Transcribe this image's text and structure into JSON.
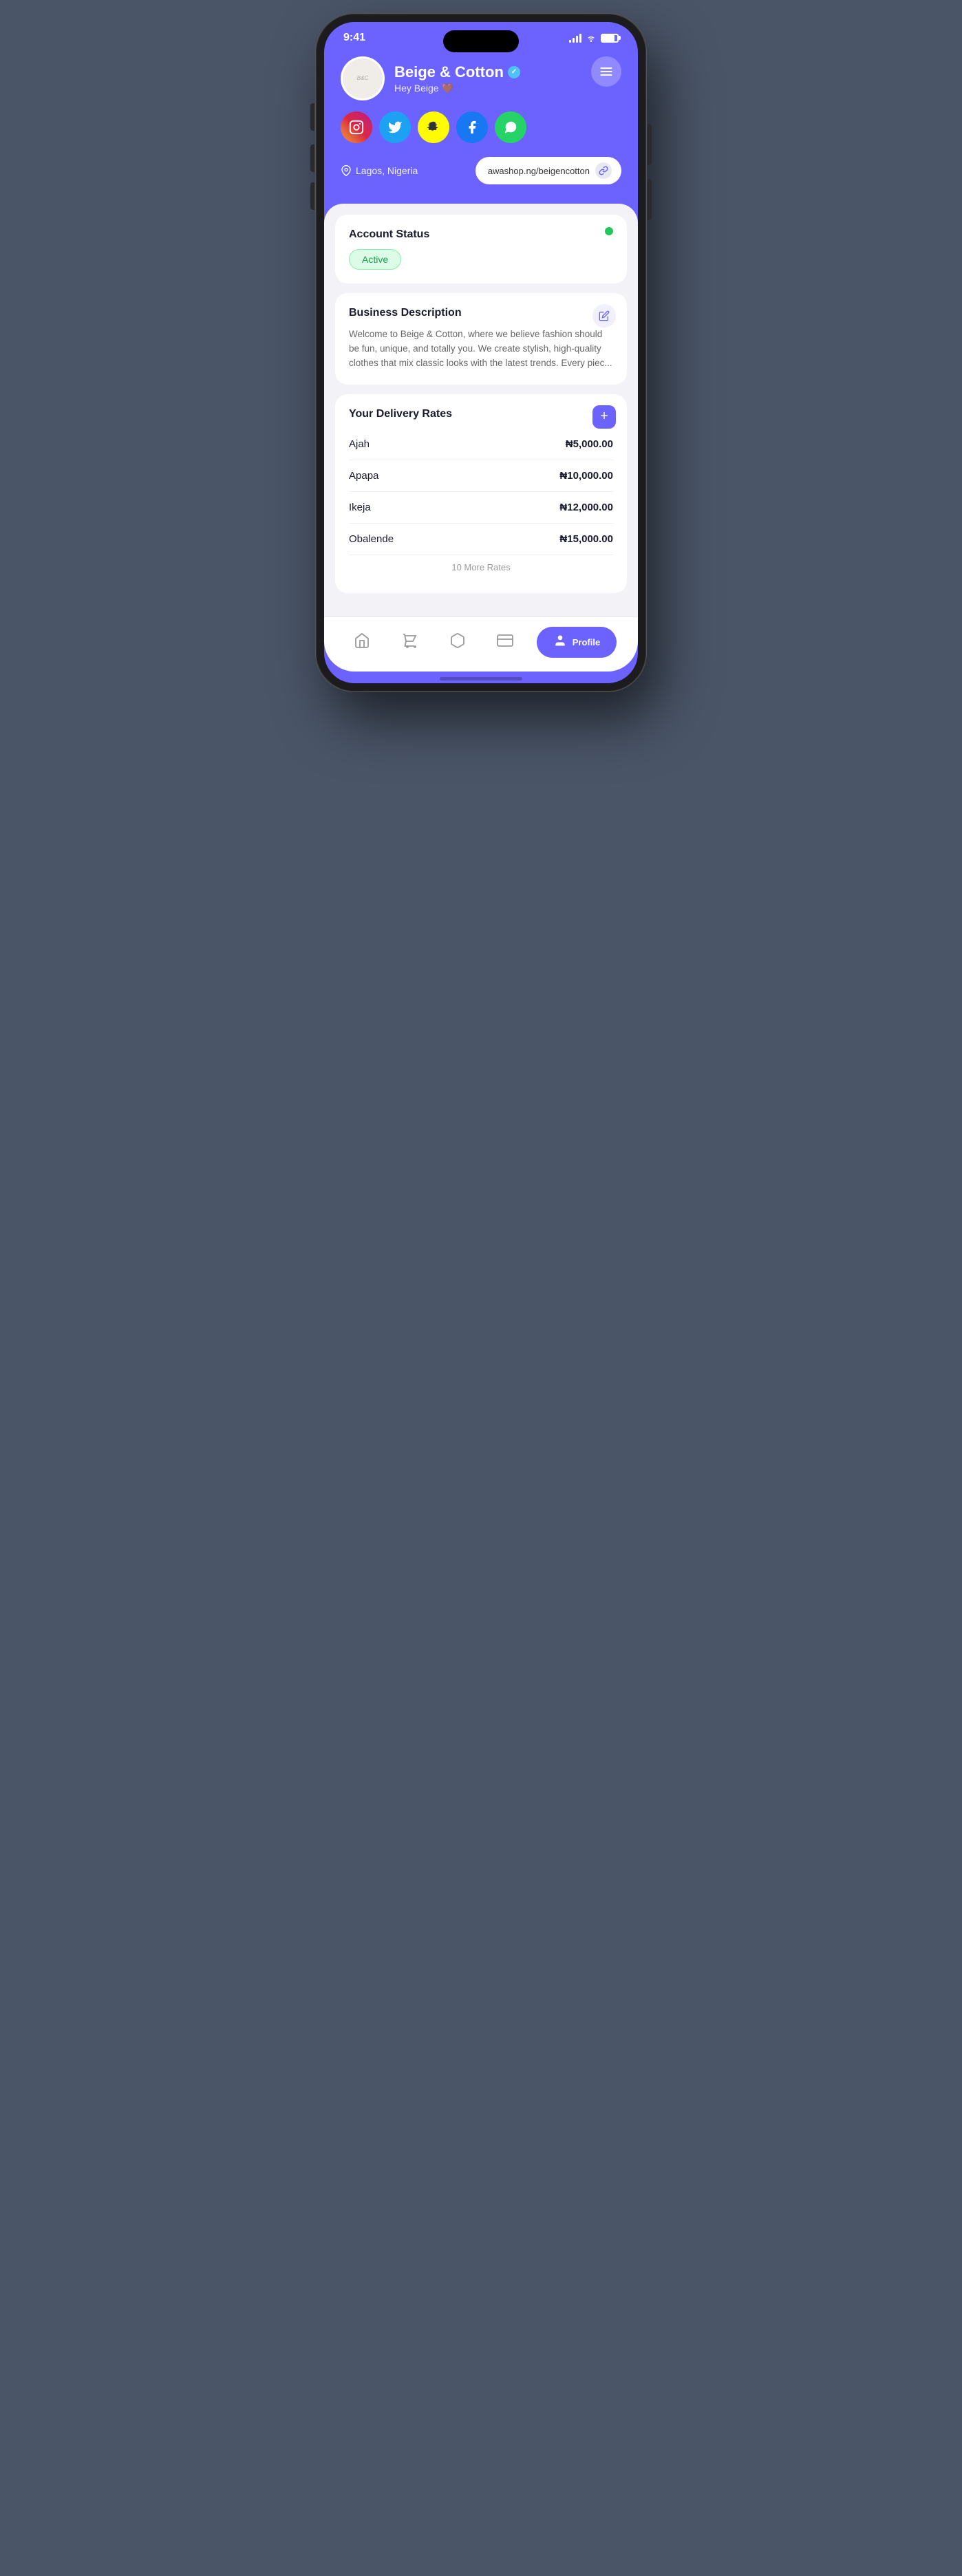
{
  "status_bar": {
    "time": "9:41",
    "signal": "signal",
    "wifi": "wifi",
    "battery": "battery"
  },
  "header": {
    "store_name": "Beige & Cotton",
    "greeting": "Hey Beige 🤎",
    "verified": true,
    "avatar_initials": "B&C",
    "location": "Lagos, Nigeria",
    "store_url": "awashop.ng/beigencotton",
    "settings_icon": "⇌"
  },
  "social_icons": [
    {
      "id": "instagram",
      "symbol": "📷",
      "class": "si-instagram",
      "label": "Instagram"
    },
    {
      "id": "twitter",
      "symbol": "🐦",
      "class": "si-twitter",
      "label": "Twitter"
    },
    {
      "id": "snapchat",
      "symbol": "👻",
      "class": "si-snapchat",
      "label": "Snapchat"
    },
    {
      "id": "facebook",
      "symbol": "f",
      "class": "si-facebook",
      "label": "Facebook"
    },
    {
      "id": "whatsapp",
      "symbol": "✓",
      "class": "si-whatsapp",
      "label": "WhatsApp"
    }
  ],
  "account_status": {
    "title": "Account Status",
    "status": "Active"
  },
  "business_description": {
    "title": "Business Description",
    "text": "Welcome to Beige & Cotton, where we believe fashion should be fun, unique, and totally you. We create stylish, high-quality clothes that mix classic looks with the latest trends. Every piec..."
  },
  "delivery_rates": {
    "title": "Your Delivery Rates",
    "more_text": "10 More Rates",
    "rates": [
      {
        "location": "Ajah",
        "price": "₦5,000.00"
      },
      {
        "location": "Apapa",
        "price": "₦10,000.00"
      },
      {
        "location": "Ikeja",
        "price": "₦12,000.00"
      },
      {
        "location": "Obalende",
        "price": "₦15,000.00"
      }
    ]
  },
  "bottom_nav": {
    "items": [
      {
        "id": "home",
        "icon": "⌂",
        "label": "",
        "active": false
      },
      {
        "id": "orders",
        "icon": "🪣",
        "label": "",
        "active": false
      },
      {
        "id": "products",
        "icon": "⬡",
        "label": "",
        "active": false
      },
      {
        "id": "wallet",
        "icon": "🗂",
        "label": "",
        "active": false
      },
      {
        "id": "profile",
        "icon": "👤",
        "label": "Profile",
        "active": true
      }
    ]
  },
  "colors": {
    "brand_purple": "#6c63ff",
    "active_green": "#22c55e",
    "active_badge_bg": "#dcfce7",
    "active_badge_text": "#16a34a"
  }
}
